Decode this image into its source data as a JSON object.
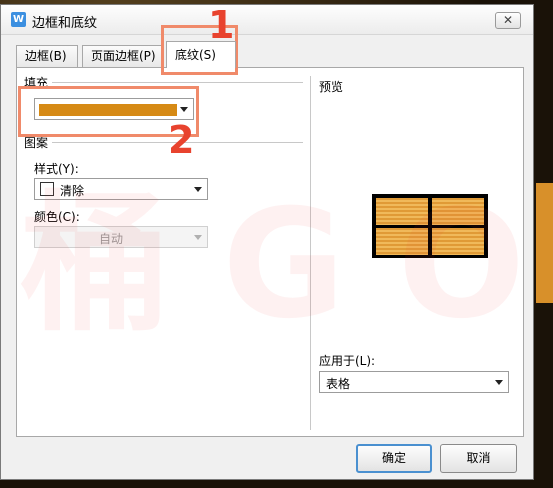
{
  "window": {
    "title": "边框和底纹",
    "app_icon_letter": "W",
    "close_symbol": "✕"
  },
  "tabs": [
    {
      "label": "边框(B)",
      "active": false
    },
    {
      "label": "页面边框(P)",
      "active": false
    },
    {
      "label": "底纹(S)",
      "active": true
    }
  ],
  "fill": {
    "label": "填充",
    "color": "#d68a15"
  },
  "pattern": {
    "label": "图案",
    "style_label": "样式(Y):",
    "style_value": "清除",
    "color_label": "颜色(C):",
    "color_value": "自动"
  },
  "preview": {
    "label": "预览",
    "cell_color": "#e09a36"
  },
  "apply_to": {
    "label": "应用于(L):",
    "value": "表格"
  },
  "buttons": {
    "ok": "确定",
    "cancel": "取消"
  },
  "annotations": {
    "step1": "1",
    "step2": "2",
    "color": "#e8432e"
  },
  "watermark_text": "桶 G O"
}
